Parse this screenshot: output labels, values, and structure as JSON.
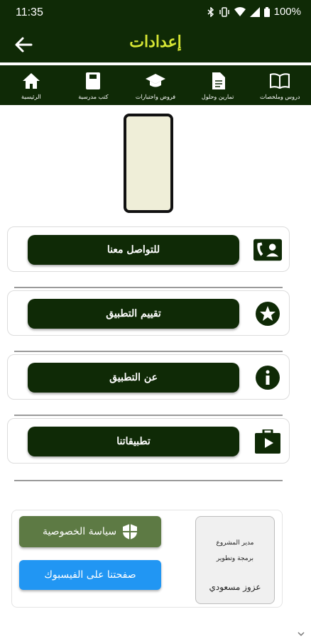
{
  "status": {
    "time": "11:35",
    "battery": "100%"
  },
  "appbar": {
    "title": "إعدادات"
  },
  "tabs": [
    {
      "label": "دروس وملخصات",
      "icon": "book-open-icon"
    },
    {
      "label": "تمارين وحلول",
      "icon": "document-icon"
    },
    {
      "label": "فروض واختبارات",
      "icon": "graduation-cap-icon"
    },
    {
      "label": "كتب مدرسية",
      "icon": "book-icon"
    },
    {
      "label": "الرئيسية",
      "icon": "home-icon"
    }
  ],
  "menu": {
    "contact": "للتواصل معنا",
    "rate": "تقييم التطبيق",
    "about": "عن التطبيق",
    "apps": "تطبيقاتنا"
  },
  "bottom": {
    "privacy": "سياسة الخصوصية",
    "facebook": "صفحتنا على الفيسبوك",
    "credit_line1": "مدير المشروع",
    "credit_line2": "برمجة وتطوير",
    "credit_name": "عزوز مسعودي"
  },
  "colors": {
    "primary": "#0f2a06",
    "accent": "#d6e634",
    "privacy": "#5d7a44",
    "facebook": "#2196f3"
  }
}
